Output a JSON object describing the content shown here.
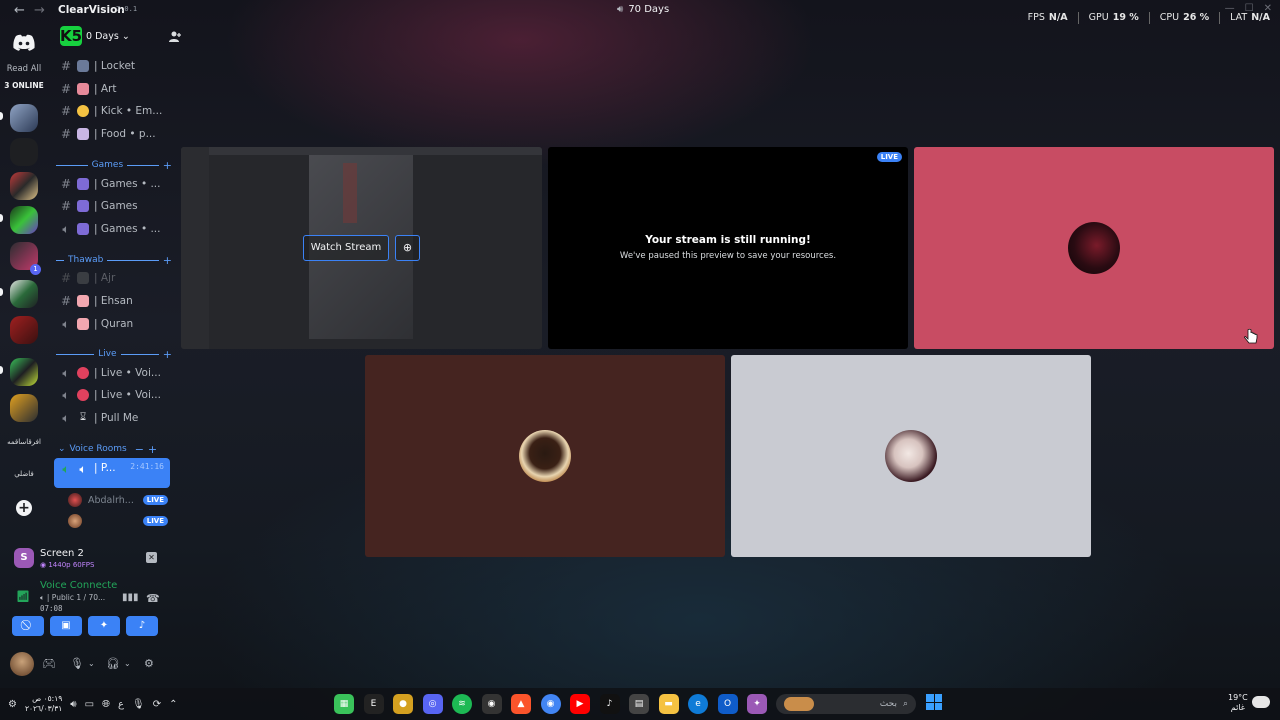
{
  "titlebar": {
    "window_title": "70 Days"
  },
  "stats": [
    {
      "label": "FPS",
      "value": "N/A"
    },
    {
      "label": "GPU",
      "value": "19 %"
    },
    {
      "label": "CPU",
      "value": "26 %"
    },
    {
      "label": "LAT",
      "value": "N/A"
    }
  ],
  "rail": {
    "read_all": "Read All",
    "online": "3 ONLINE",
    "text_server_1": "افرقاساقمه",
    "text_server_2": "فاضلي"
  },
  "sidebar": {
    "brand": "ClearVision",
    "brand_version": "7.0.1",
    "server_logo": "K5",
    "server_name": "0 Days",
    "channels_top": [
      {
        "type": "text",
        "label": "| Locket",
        "color": "#6b7a99"
      },
      {
        "type": "text",
        "label": "| Art",
        "color": "#e78a9a"
      },
      {
        "type": "text",
        "label": "| Kick • Em...",
        "color": "#f5c242"
      },
      {
        "type": "text",
        "label": "| Food • p...",
        "color": "#c9b6e4"
      }
    ],
    "cat_games": "Games",
    "channels_games": [
      {
        "type": "text",
        "label": "| Games • ...",
        "color": "#7e6bd6"
      },
      {
        "type": "text",
        "label": "| Games",
        "color": "#7e6bd6"
      },
      {
        "type": "voice",
        "label": "| Games • ...",
        "color": "#7e6bd6"
      }
    ],
    "cat_thawab": "Thawab",
    "channels_thawab": [
      {
        "type": "text",
        "label": "| Ajr",
        "color": "#4a4d52",
        "muted": true
      },
      {
        "type": "text",
        "label": "| Ehsan",
        "color": "#f2a7b0"
      },
      {
        "type": "voice",
        "label": "| Quran",
        "color": "#f2a7b0"
      }
    ],
    "cat_live": "Live",
    "channels_live": [
      {
        "type": "voice",
        "label": "| Live • Voi...",
        "color": "#e0415e"
      },
      {
        "type": "voice",
        "label": "| Live • Voi...",
        "color": "#e0415e"
      },
      {
        "type": "voice",
        "label": "| Pull Me",
        "color": "#dbdee1"
      }
    ],
    "cat_voice": "Voice Rooms",
    "active_channel": {
      "label": "| P...",
      "timer": "2:41:16"
    },
    "voice_users": [
      {
        "name": "Abdalrh...",
        "live": "LIVE"
      },
      {
        "name": "",
        "live": "LIVE"
      }
    ]
  },
  "stream_panel": {
    "avatar": "S",
    "title": "Screen 2",
    "quality": "1440p 60FPS",
    "voice_title": "Voice Connecte",
    "voice_sub": "| Public 1 / 70...",
    "voice_time": "07:08"
  },
  "tiles": {
    "watch_stream": "Watch Stream",
    "live": "LIVE",
    "paused_title": "Your stream is still running!",
    "paused_sub": "We've paused this preview to save your resources."
  },
  "taskbar": {
    "clock_time": "٠٥:١٩ ص",
    "clock_date": "٢٠٢٦/٠٣/٣١",
    "lang": "ع",
    "search_placeholder": "بحث",
    "temperature": "19°C",
    "weather": "غائم"
  },
  "colors": {
    "accent": "#3b82f6",
    "tile_pink": "#c84c63",
    "tile_brown": "#452420",
    "tile_grey": "#c9cbd2"
  }
}
